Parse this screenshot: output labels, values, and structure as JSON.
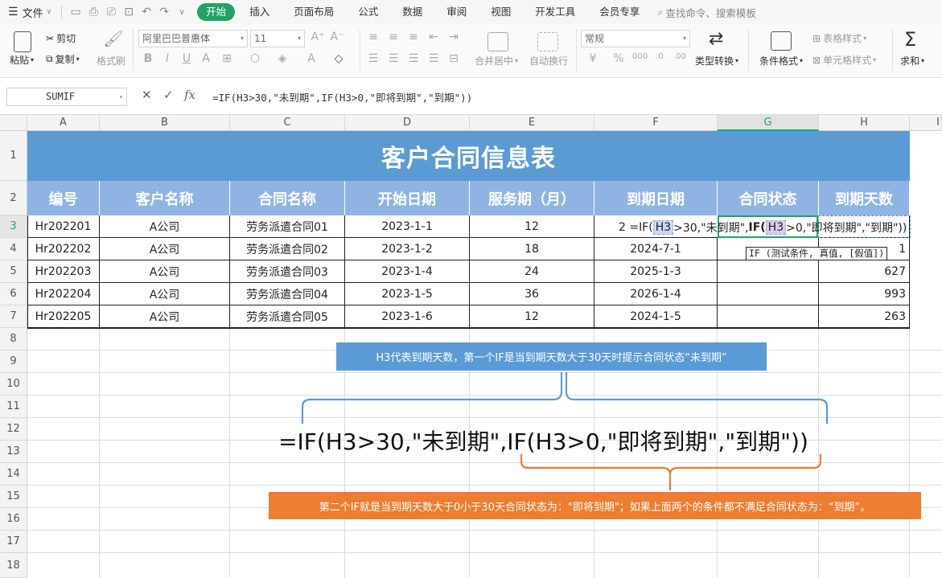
{
  "menubar": {
    "file_label": "文件",
    "tabs": [
      {
        "label": "开始",
        "active": true
      },
      {
        "label": "插入"
      },
      {
        "label": "页面布局"
      },
      {
        "label": "公式"
      },
      {
        "label": "数据"
      },
      {
        "label": "审阅"
      },
      {
        "label": "视图"
      },
      {
        "label": "开发工具"
      },
      {
        "label": "会员专享"
      }
    ],
    "search_label": "查找命令、搜索模板"
  },
  "ribbon": {
    "paste": "粘贴",
    "cut": "剪切",
    "copy": "复制",
    "format_painter": "格式刷",
    "font_name": "阿里巴巴普惠体",
    "font_size": "11",
    "merge_center": "合并居中",
    "wrap_text": "自动换行",
    "number_format": "常规",
    "type_convert": "类型转换",
    "cond_format": "条件格式",
    "table_style": "表格样式",
    "cell_style": "单元格样式",
    "sum": "求和"
  },
  "formula_bar": {
    "name_box": "SUMIF",
    "formula": "=IF(H3>30,\"未到期\",IF(H3>0,\"即将到期\",\"到期\"))"
  },
  "columns": [
    "A",
    "B",
    "C",
    "D",
    "E",
    "F",
    "G",
    "H",
    "I"
  ],
  "rows": [
    "1",
    "2",
    "3",
    "4",
    "5",
    "6",
    "7",
    "8",
    "9",
    "10",
    "11",
    "12",
    "13",
    "14",
    "15",
    "16",
    "17",
    "18"
  ],
  "sheet": {
    "title": "客户合同信息表",
    "headers": [
      "编号",
      "客户名称",
      "合同名称",
      "开始日期",
      "服务期（月）",
      "到期日期",
      "合同状态",
      "到期天数"
    ],
    "rows": [
      [
        "Hr202201",
        "A公司",
        "劳务派遣合同01",
        "2023-1-1",
        "12",
        "",
        "",
        ""
      ],
      [
        "Hr202202",
        "A公司",
        "劳务派遣合同02",
        "2023-1-2",
        "18",
        "2024-7-1",
        "",
        ""
      ],
      [
        "Hr202203",
        "A公司",
        "劳务派遣合同03",
        "2023-1-4",
        "24",
        "2025-1-3",
        "",
        "627"
      ],
      [
        "Hr202204",
        "A公司",
        "劳务派遣合同04",
        "2023-1-5",
        "36",
        "2026-1-4",
        "",
        "993"
      ],
      [
        "Hr202205",
        "A公司",
        "劳务派遣合同05",
        "2023-1-6",
        "12",
        "2024-1-5",
        "",
        "263"
      ]
    ],
    "editing_prefix": "2 =IF(",
    "editing_ref1": "H3",
    "editing_mid": ">30,\"未到期\",",
    "editing_if": "IF(",
    "editing_ref2": "H3",
    "editing_tail": ">0,\"即将到期\",\"到期\"))",
    "tooltip": "IF (测试条件, 真值, [假值])",
    "h4_partial": "1"
  },
  "annotations": {
    "note1": "H3代表到期天数，第一个IF是当到期天数大于30天时提示合同状态“未到期”",
    "big_formula": "=IF(H3>30,\"未到期\",IF(H3>0,\"即将到期\",\"到期\"))",
    "note2": "第二个IF就是当到期天数大于0小于30天合同状态为：\"即将到期\"；如果上面两个的条件都不满足合同状态为：“到期”。"
  },
  "colors": {
    "accent": "#21a366",
    "title_fill": "#5b9bd5",
    "header_fill": "#8fb4e3",
    "note2_fill": "#ed7d31"
  }
}
